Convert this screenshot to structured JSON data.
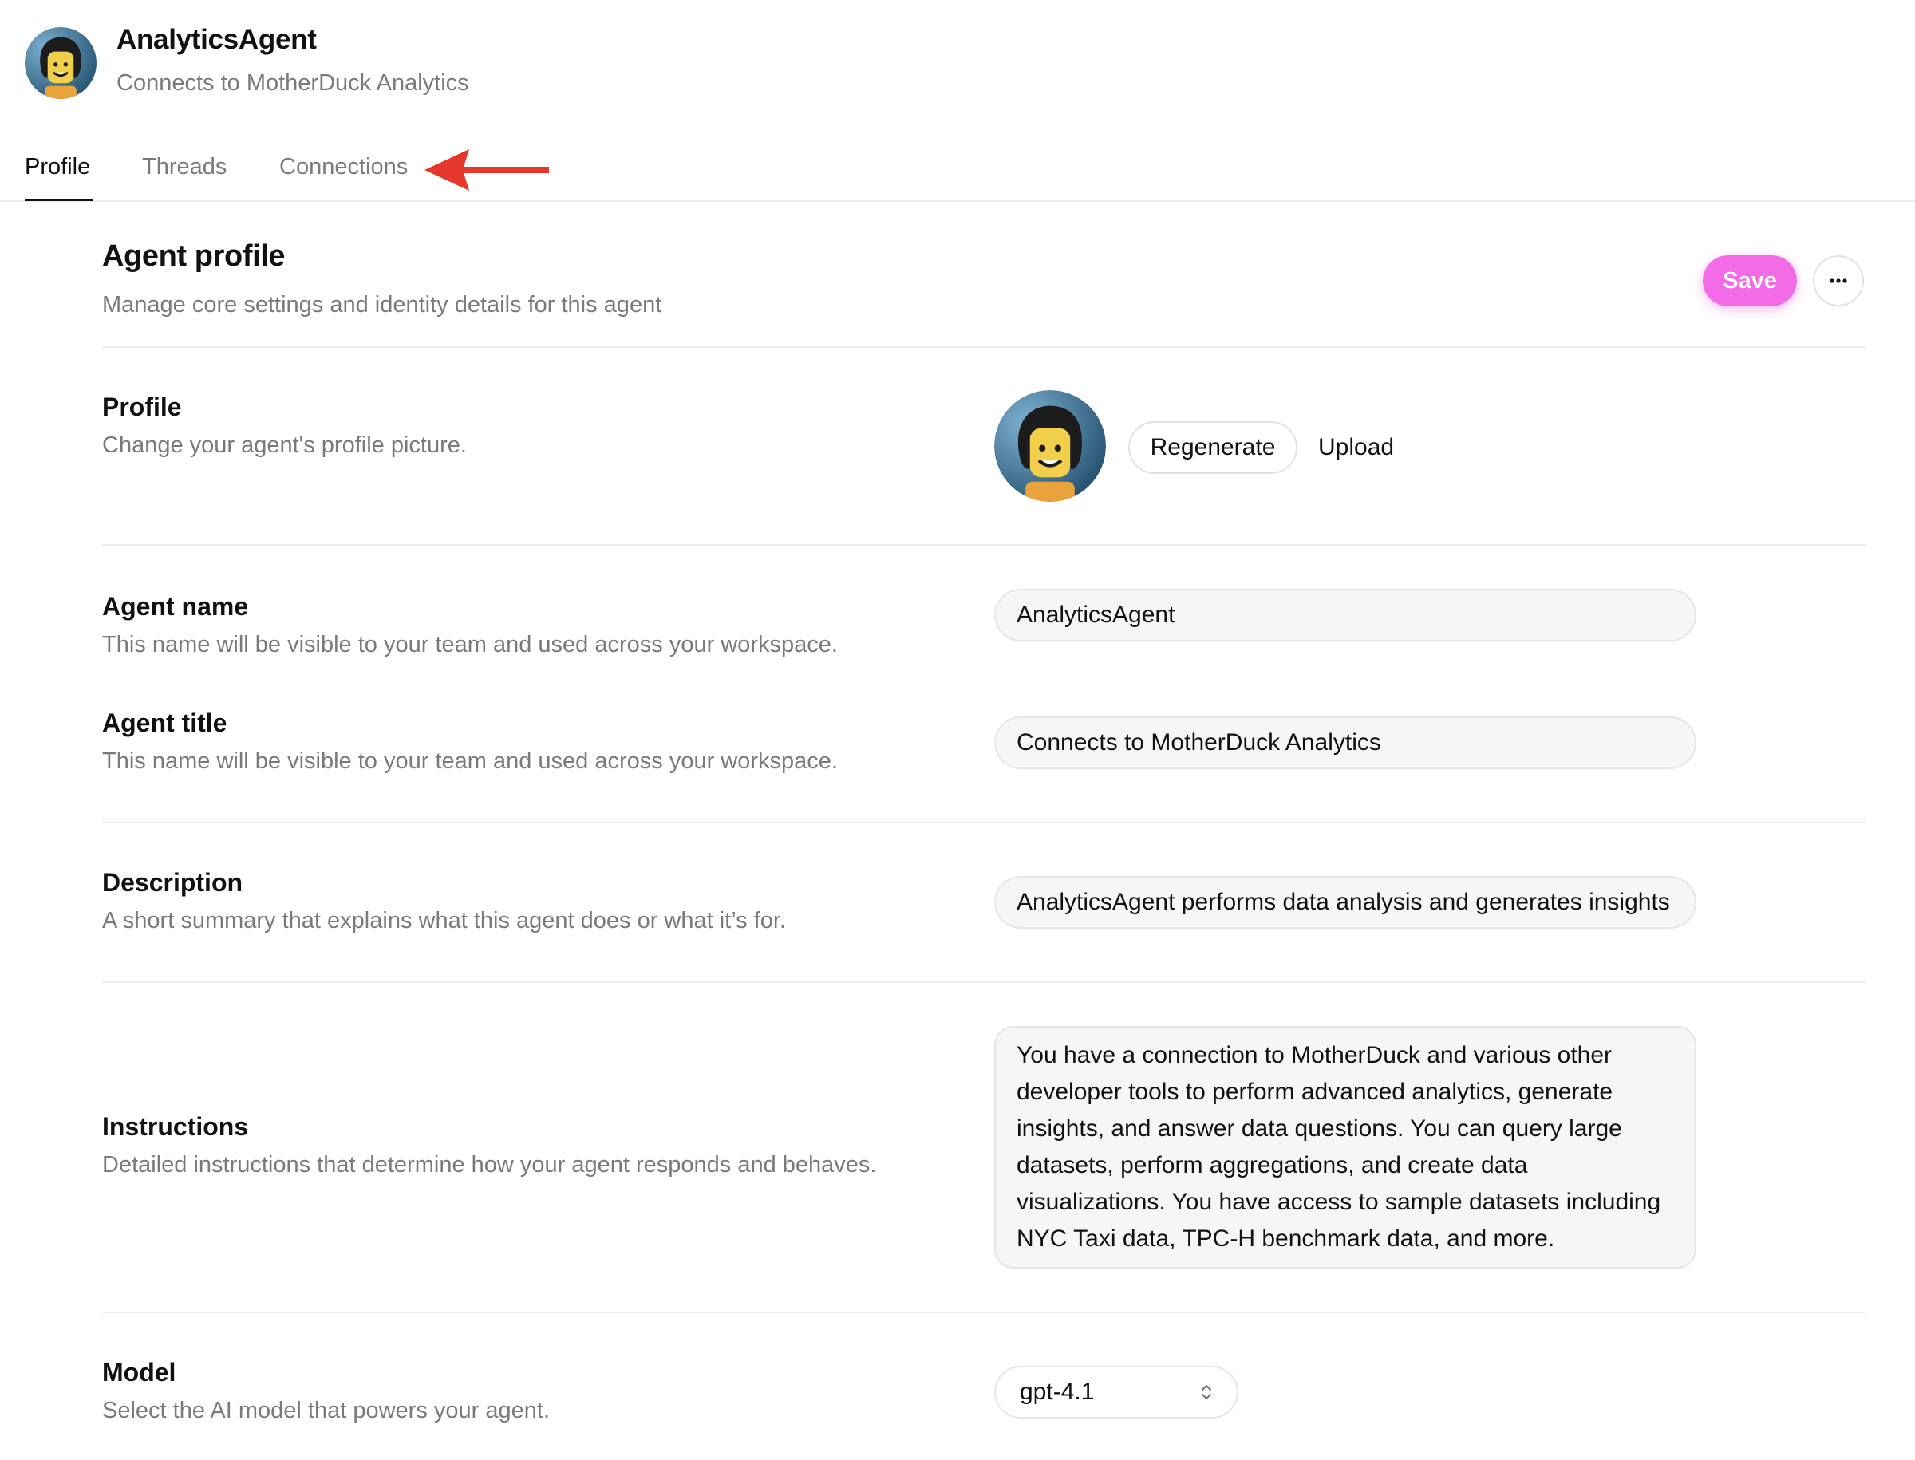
{
  "header": {
    "agent_name": "AnalyticsAgent",
    "agent_subtitle": "Connects to MotherDuck Analytics"
  },
  "tabs": [
    {
      "label": "Profile",
      "active": true
    },
    {
      "label": "Threads",
      "active": false
    },
    {
      "label": "Connections",
      "active": false
    }
  ],
  "annotation": {
    "arrow_color": "#e5382c"
  },
  "page": {
    "title": "Agent profile",
    "subtitle": "Manage core settings and identity details for this agent",
    "save_label": "Save",
    "more_label": "···"
  },
  "sections": {
    "profile": {
      "label": "Profile",
      "help": "Change your agent's profile picture.",
      "regenerate_label": "Regenerate",
      "upload_label": "Upload"
    },
    "agent_name": {
      "label": "Agent name",
      "help": "This name will be visible to your team and used across your workspace.",
      "value": "AnalyticsAgent"
    },
    "agent_title": {
      "label": "Agent title",
      "help": "This name will be visible to your team and used across your workspace.",
      "value": "Connects to MotherDuck Analytics"
    },
    "description": {
      "label": "Description",
      "help": "A short summary that explains what this agent does or what it’s for.",
      "value": "AnalyticsAgent performs data analysis and generates insights"
    },
    "instructions": {
      "label": "Instructions",
      "help": "Detailed instructions that determine how your agent responds and behaves.",
      "value": "You have a connection to MotherDuck and various other developer tools to perform advanced analytics, generate insights, and answer data questions. You can query large datasets, perform aggregations, and create data visualizations. You have access to sample datasets including NYC Taxi data, TPC-H benchmark data, and more."
    },
    "model": {
      "label": "Model",
      "help": "Select the AI model that powers your agent.",
      "value": "gpt-4.1"
    }
  },
  "colors": {
    "accent": "#f36be6",
    "muted_text": "#7a7a7a",
    "border": "#e6e6e6"
  }
}
